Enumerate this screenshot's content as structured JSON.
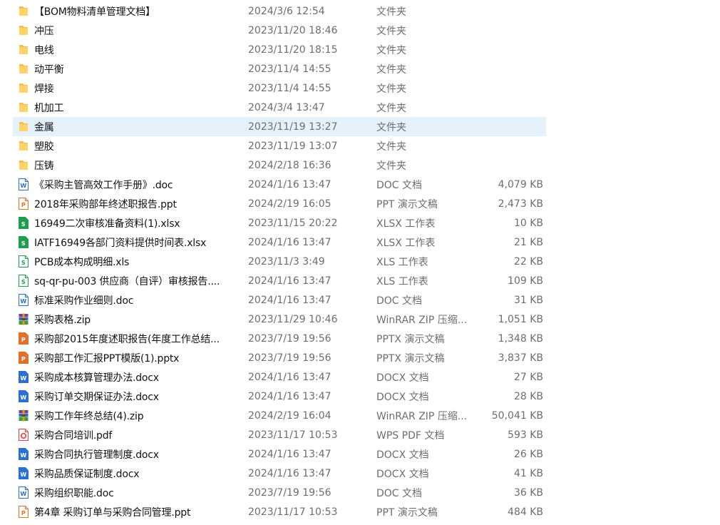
{
  "files": [
    {
      "name": "【BOM物料清单管理文档】",
      "date": "2024/3/6 12:54",
      "type": "文件夹",
      "size": "",
      "icon": "folder-icon"
    },
    {
      "name": "冲压",
      "date": "2023/11/20 18:46",
      "type": "文件夹",
      "size": "",
      "icon": "folder-icon"
    },
    {
      "name": "电线",
      "date": "2023/11/20 18:15",
      "type": "文件夹",
      "size": "",
      "icon": "folder-icon"
    },
    {
      "name": "动平衡",
      "date": "2023/11/4 14:55",
      "type": "文件夹",
      "size": "",
      "icon": "folder-icon"
    },
    {
      "name": "焊接",
      "date": "2023/11/4 14:55",
      "type": "文件夹",
      "size": "",
      "icon": "folder-icon"
    },
    {
      "name": "机加工",
      "date": "2024/3/4 13:47",
      "type": "文件夹",
      "size": "",
      "icon": "folder-icon"
    },
    {
      "name": "金属",
      "date": "2023/11/19 13:27",
      "type": "文件夹",
      "size": "",
      "icon": "folder-icon",
      "selected": true
    },
    {
      "name": "塑胶",
      "date": "2023/11/19 13:07",
      "type": "文件夹",
      "size": "",
      "icon": "folder-icon"
    },
    {
      "name": "压铸",
      "date": "2024/2/18 16:36",
      "type": "文件夹",
      "size": "",
      "icon": "folder-icon"
    },
    {
      "name": "《采购主管高效工作手册》.doc",
      "date": "2024/1/16 13:47",
      "type": "DOC 文档",
      "size": "4,079 KB",
      "icon": "word-doc-icon"
    },
    {
      "name": "2018年采购部年终述职报告.ppt",
      "date": "2024/2/19 16:05",
      "type": "PPT 演示文稿",
      "size": "2,473 KB",
      "icon": "ppt-outline-icon"
    },
    {
      "name": "16949二次审核准备资料(1).xlsx",
      "date": "2023/11/15 20:22",
      "type": "XLSX 工作表",
      "size": "10 KB",
      "icon": "excel-icon"
    },
    {
      "name": "IATF16949各部门资料提供时间表.xlsx",
      "date": "2024/1/16 13:47",
      "type": "XLSX 工作表",
      "size": "21 KB",
      "icon": "excel-icon"
    },
    {
      "name": "PCB成本构成明细.xls",
      "date": "2023/11/3 3:49",
      "type": "XLS 工作表",
      "size": "22 KB",
      "icon": "excel-outline-icon"
    },
    {
      "name": "sq-qr-pu-003 供应商（自评）审核报告....",
      "date": "2024/1/16 13:47",
      "type": "XLS 工作表",
      "size": "109 KB",
      "icon": "excel-outline-icon"
    },
    {
      "name": "标准采购作业细则.doc",
      "date": "2024/1/16 13:47",
      "type": "DOC 文档",
      "size": "31 KB",
      "icon": "word-doc-icon"
    },
    {
      "name": "采购表格.zip",
      "date": "2023/11/29 10:46",
      "type": "WinRAR ZIP 压缩...",
      "size": "1,051 KB",
      "icon": "winrar-icon"
    },
    {
      "name": "采购部2015年度述职报告(年度工作总结...",
      "date": "2023/7/19 19:56",
      "type": "PPTX 演示文稿",
      "size": "1,348 KB",
      "icon": "ppt-icon"
    },
    {
      "name": "采购部工作汇报PPT模版(1).pptx",
      "date": "2023/7/19 19:56",
      "type": "PPTX 演示文稿",
      "size": "3,837 KB",
      "icon": "ppt-icon"
    },
    {
      "name": "采购成本核算管理办法.docx",
      "date": "2024/1/16 13:47",
      "type": "DOCX 文档",
      "size": "27 KB",
      "icon": "word-icon"
    },
    {
      "name": "采购订单交期保证办法.docx",
      "date": "2024/1/16 13:47",
      "type": "DOCX 文档",
      "size": "28 KB",
      "icon": "word-icon"
    },
    {
      "name": "采购工作年终总结(4).zip",
      "date": "2024/2/19 16:04",
      "type": "WinRAR ZIP 压缩...",
      "size": "50,041 KB",
      "icon": "winrar-icon"
    },
    {
      "name": "采购合同培训.pdf",
      "date": "2023/11/17 10:53",
      "type": "WPS PDF 文档",
      "size": "593 KB",
      "icon": "pdf-icon"
    },
    {
      "name": "采购合同执行管理制度.docx",
      "date": "2024/1/16 13:47",
      "type": "DOCX 文档",
      "size": "26 KB",
      "icon": "word-icon"
    },
    {
      "name": "采购品质保证制度.docx",
      "date": "2024/1/16 13:47",
      "type": "DOCX 文档",
      "size": "41 KB",
      "icon": "word-icon"
    },
    {
      "name": "采购组织职能.doc",
      "date": "2023/7/19 19:56",
      "type": "DOC 文档",
      "size": "36 KB",
      "icon": "word-doc-icon"
    },
    {
      "name": "第4章 采购订单与采购合同管理.ppt",
      "date": "2023/11/17 10:53",
      "type": "PPT 演示文稿",
      "size": "484 KB",
      "icon": "ppt-outline-icon"
    }
  ],
  "colors": {
    "folder": "#f5c04a",
    "word": "#2b6fd1",
    "excel": "#1f9e4e",
    "ppt": "#e2702b",
    "pdf": "#e0443a",
    "selection": "#e5f1fb"
  }
}
